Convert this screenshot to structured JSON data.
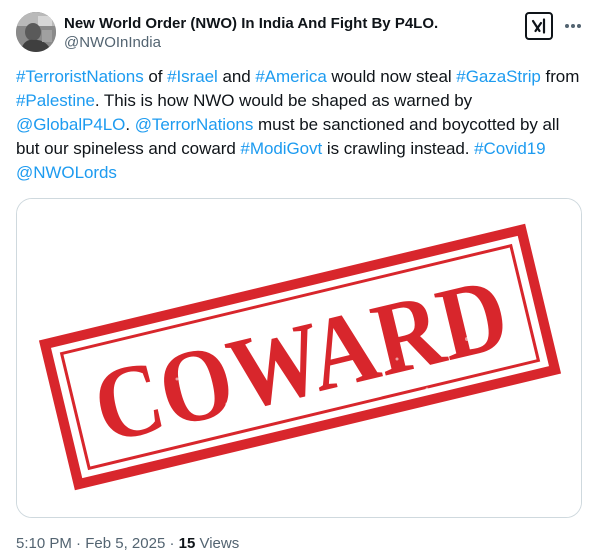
{
  "author": {
    "display_name": "New World Order (NWO) In India And Fight By P4LO.",
    "handle": "@NWOInIndia"
  },
  "icons": {
    "grok": "grok-icon",
    "more": "more-options-icon"
  },
  "tweet": {
    "segments": [
      {
        "text": "#TerroristNations",
        "link": true
      },
      {
        "text": " of ",
        "link": false
      },
      {
        "text": "#Israel",
        "link": true
      },
      {
        "text": " and ",
        "link": false
      },
      {
        "text": "#America",
        "link": true
      },
      {
        "text": " would now steal ",
        "link": false
      },
      {
        "text": "#GazaStrip",
        "link": true
      },
      {
        "text": " from ",
        "link": false
      },
      {
        "text": "#Palestine",
        "link": true
      },
      {
        "text": ". This is how NWO would be shaped as warned by ",
        "link": false
      },
      {
        "text": "@GlobalP4LO",
        "link": true
      },
      {
        "text": ". ",
        "link": false
      },
      {
        "text": "@TerrorNations",
        "link": true
      },
      {
        "text": " must be sanctioned and boycotted by all but our spineless and coward ",
        "link": false
      },
      {
        "text": "#ModiGovt",
        "link": true
      },
      {
        "text": " is crawling instead. ",
        "link": false
      },
      {
        "text": "#Covid19",
        "link": true
      },
      {
        "text": " ",
        "link": false
      },
      {
        "text": "@NWOLords",
        "link": true
      }
    ]
  },
  "media": {
    "stamp_text": "COWARD",
    "stamp_color": "#d8262c"
  },
  "meta": {
    "time": "5:10 PM",
    "date": "Feb 5, 2025",
    "separator": "·",
    "views_count": "15",
    "views_label": "Views"
  },
  "colors": {
    "link": "#1d9bf0",
    "secondary_text": "#536471",
    "primary_text": "#0f1419",
    "border": "#cfd9de"
  }
}
